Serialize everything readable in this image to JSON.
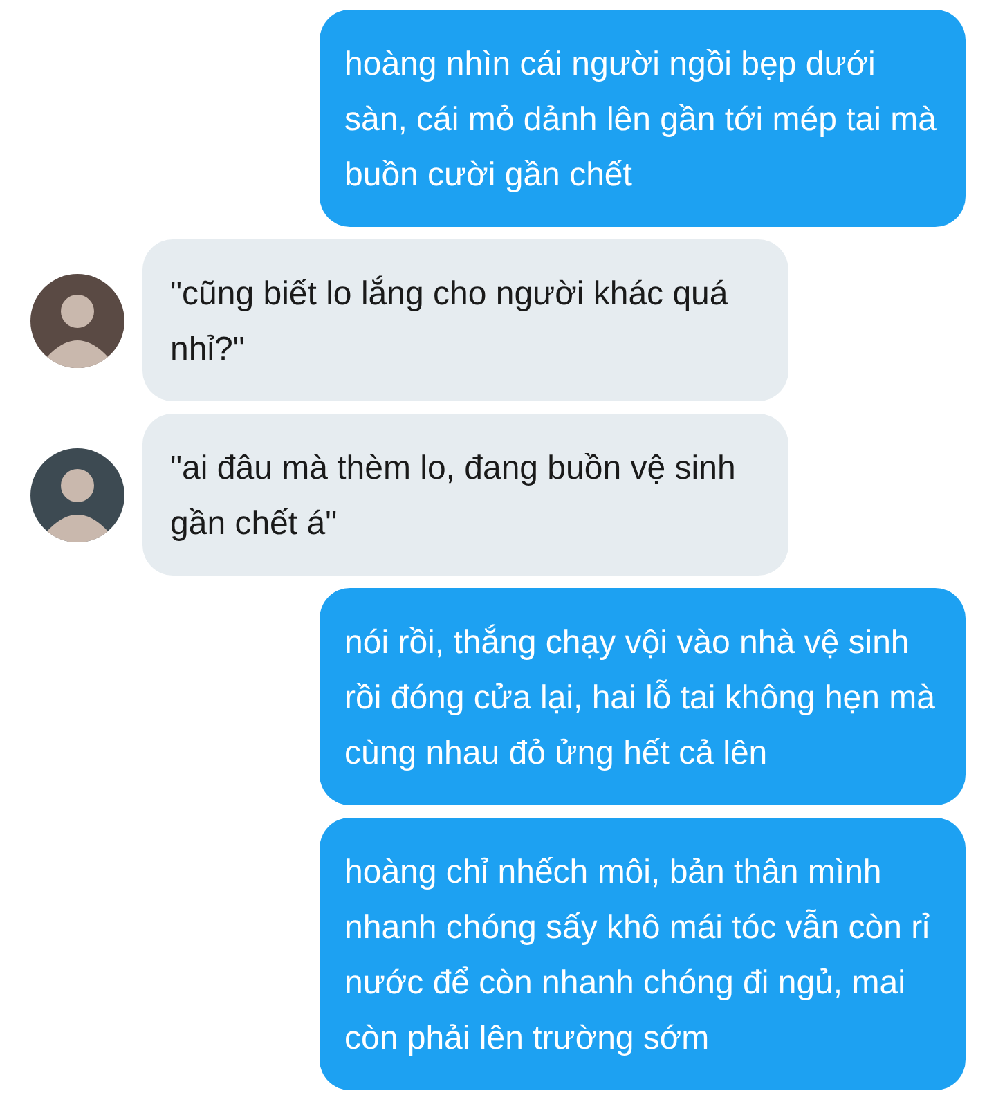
{
  "messages": [
    {
      "kind": "outgoing",
      "text": "hoàng nhìn cái người ngồi bẹp dưới sàn, cái mỏ dảnh lên gần tới mép tai mà buồn cười gần chết"
    },
    {
      "kind": "incoming",
      "text": "\"cũng biết lo lắng cho người khác quá nhỉ?\""
    },
    {
      "kind": "incoming",
      "text": "\"ai đâu mà thèm lo, đang buồn vệ sinh gần chết á\""
    },
    {
      "kind": "outgoing",
      "text": "nói rồi, thắng chạy vội vào nhà vệ sinh rồi đóng cửa lại, hai lỗ tai không hẹn mà cùng nhau đỏ ửng hết cả lên"
    },
    {
      "kind": "outgoing",
      "text": "hoàng chỉ nhếch môi, bản thân mình nhanh chóng sấy khô mái tóc vẫn còn rỉ nước để còn nhanh chóng đi ngủ, mai còn phải lên trường sớm"
    }
  ]
}
